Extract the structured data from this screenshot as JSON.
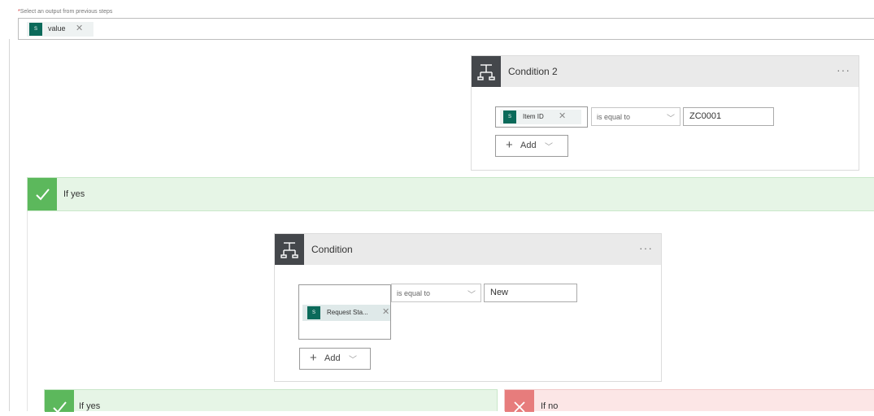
{
  "select_output": {
    "required_mark": "*",
    "label": "Select an output from previous steps",
    "token": {
      "label": "value",
      "icon": "sharepoint-icon"
    }
  },
  "condition2": {
    "title": "Condition 2",
    "menu": "···",
    "token": {
      "label": "Item ID",
      "icon": "sharepoint-icon"
    },
    "operator": "is equal to",
    "value": "ZC0001",
    "add_label": "Add"
  },
  "branch_if_yes": {
    "label": "If yes"
  },
  "condition": {
    "title": "Condition",
    "menu": "···",
    "token": {
      "label": "Request Sta...",
      "icon": "sharepoint-icon"
    },
    "operator": "is equal to",
    "value": "New",
    "add_label": "Add"
  },
  "inner_if_yes": {
    "label": "If yes"
  },
  "inner_if_no": {
    "label": "If no"
  },
  "colors": {
    "token_bg": "#0b6a5a",
    "header_icon_bg": "#44474b",
    "yes_green": "#5cb85c",
    "yes_bg": "#e6f5e6",
    "no_red": "#e77c7c",
    "no_bg": "#fce6e6"
  }
}
